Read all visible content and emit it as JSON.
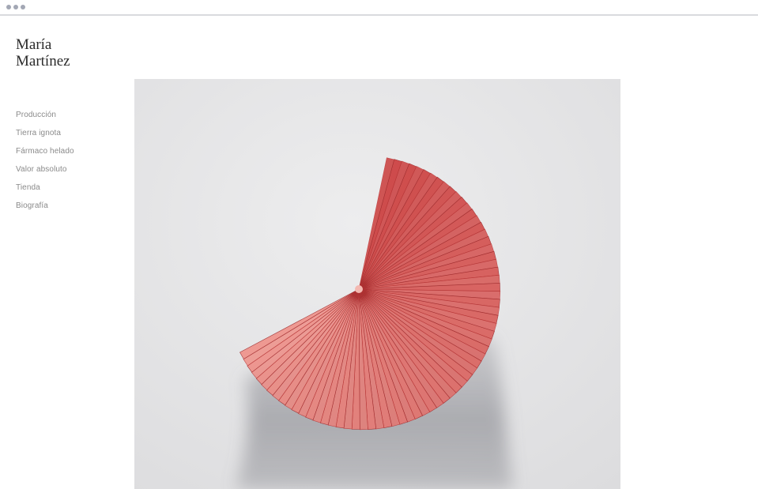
{
  "site": {
    "title_line1": "María",
    "title_line2": "Martínez"
  },
  "nav": {
    "items": [
      {
        "label": "Producción"
      },
      {
        "label": "Tierra ignota"
      },
      {
        "label": "Fármaco helado"
      },
      {
        "label": "Valor absoluto"
      },
      {
        "label": "Tienda"
      },
      {
        "label": "Biografía"
      }
    ]
  },
  "colors": {
    "background": "#ffffff",
    "paper": "#e9e9ea",
    "fan_dark": "#c93a3a",
    "fan_light": "#f29a92",
    "nav_text": "#8a8a8a"
  }
}
